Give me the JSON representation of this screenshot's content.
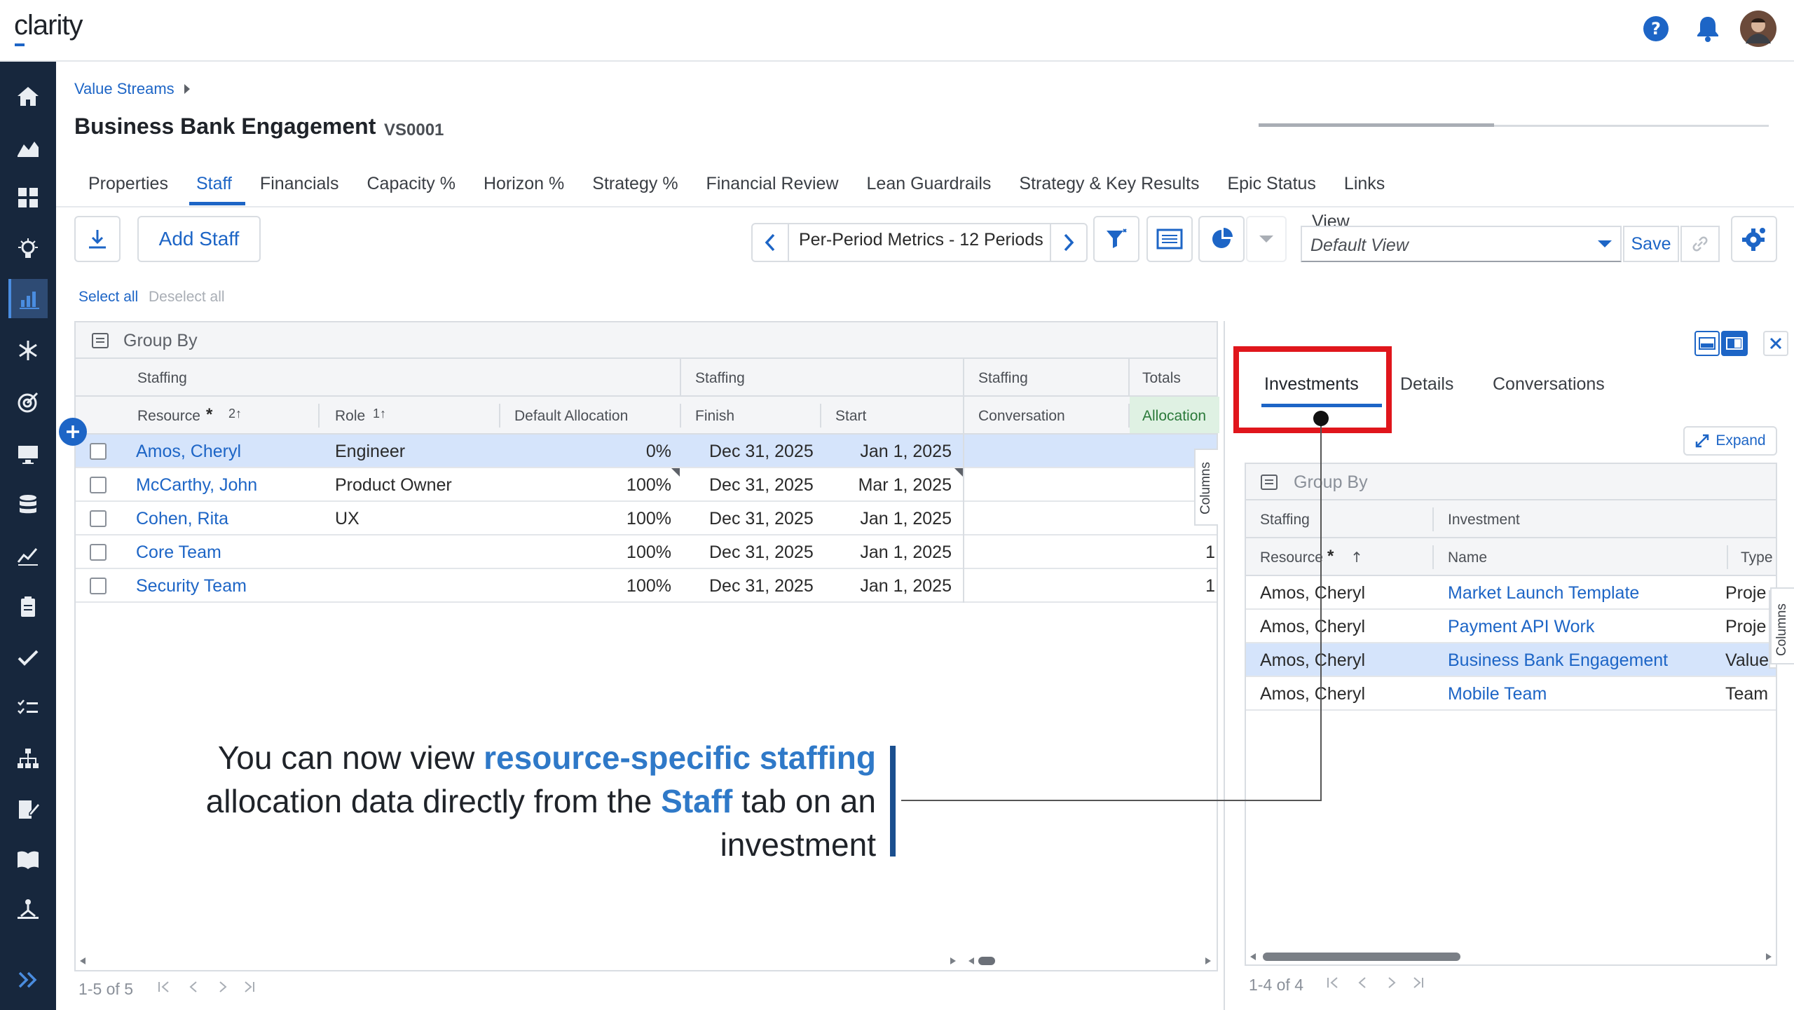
{
  "app": {
    "logo_text": "clarity"
  },
  "topbar": {
    "help_icon": "question-circle-icon",
    "bell_icon": "bell-icon",
    "avatar": "user-avatar"
  },
  "leftnav": {
    "icons": [
      "home-icon",
      "chart-area-icon",
      "grid-icon",
      "lightbulb-icon",
      "bar-chart-icon",
      "network-icon",
      "target-icon",
      "monitor-icon",
      "database-icon",
      "line-chart-icon",
      "clipboard-icon",
      "checkmark-icon",
      "checklist-icon",
      "org-chart-icon",
      "edit-doc-icon",
      "book-icon",
      "hierarchy-icon",
      "expand-icon"
    ]
  },
  "breadcrumb": {
    "label": "Value Streams"
  },
  "header": {
    "title": "Business Bank Engagement",
    "code": "VS0001"
  },
  "tabs": [
    "Properties",
    "Staff",
    "Financials",
    "Capacity %",
    "Horizon %",
    "Strategy %",
    "Financial Review",
    "Lean Guardrails",
    "Strategy & Key Results",
    "Epic Status",
    "Links"
  ],
  "active_tab": "Staff",
  "toolbar": {
    "add_staff": "Add Staff",
    "metrics_label": "Per-Period Metrics - 12 Periods",
    "view_label": "View",
    "view_value": "Default View",
    "save_label": "Save"
  },
  "selection": {
    "select_all": "Select all",
    "deselect_all": "Deselect all"
  },
  "grid": {
    "group_by": "Group By",
    "group_headers": [
      "Staffing",
      "Staffing",
      "Staffing",
      "Totals"
    ],
    "columns": {
      "resource": "Resource",
      "resource_sort": "2↑",
      "role": "Role",
      "role_sort": "1↑",
      "default_allocation": "Default Allocation",
      "finish": "Finish",
      "start": "Start",
      "conversation": "Conversation",
      "allocation": "Allocation"
    },
    "columns_tab": "Columns",
    "rows": [
      {
        "resource": "Amos, Cheryl",
        "role": "Engineer",
        "allocation": "0%",
        "finish": "Dec 31, 2025",
        "start": "Jan 1, 2025",
        "total": ""
      },
      {
        "resource": "McCarthy, John",
        "role": "Product Owner",
        "allocation": "100%",
        "finish": "Dec 31, 2025",
        "start": "Mar 1, 2025",
        "total": ""
      },
      {
        "resource": "Cohen, Rita",
        "role": "UX",
        "allocation": "100%",
        "finish": "Dec 31, 2025",
        "start": "Jan 1, 2025",
        "total": ""
      },
      {
        "resource": "Core Team",
        "role": "",
        "allocation": "100%",
        "finish": "Dec 31, 2025",
        "start": "Jan 1, 2025",
        "total": "1"
      },
      {
        "resource": "Security Team",
        "role": "",
        "allocation": "100%",
        "finish": "Dec 31, 2025",
        "start": "Jan 1, 2025",
        "total": "1"
      }
    ],
    "pager": "1-5 of 5"
  },
  "right_panel": {
    "tabs": [
      "Investments",
      "Details",
      "Conversations"
    ],
    "expand_label": "Expand",
    "group_by": "Group By",
    "group_headers": [
      "Staffing",
      "Investment"
    ],
    "columns": {
      "resource": "Resource",
      "name": "Name",
      "type": "Type"
    },
    "columns_tab": "Columns",
    "rows": [
      {
        "resource": "Amos, Cheryl",
        "name": "Market Launch Template",
        "type": "Proje"
      },
      {
        "resource": "Amos, Cheryl",
        "name": "Payment API Work",
        "type": "Proje"
      },
      {
        "resource": "Amos, Cheryl",
        "name": "Business Bank Engagement",
        "type": "Value"
      },
      {
        "resource": "Amos, Cheryl",
        "name": "Mobile Team",
        "type": "Team"
      }
    ],
    "pager": "1-4 of 4"
  },
  "callout": {
    "line1_a": "You can now view ",
    "line1_b": "resource-specific staffing",
    "line2_a": "allocation data directly from the ",
    "line2_b": "Staff",
    "line2_c": " tab on an",
    "line3": "investment"
  },
  "colors": {
    "accent": "#1d65c6",
    "nav_bg": "#17273d",
    "highlight_red": "#e0161c",
    "selected_row": "#d5e4fb"
  }
}
